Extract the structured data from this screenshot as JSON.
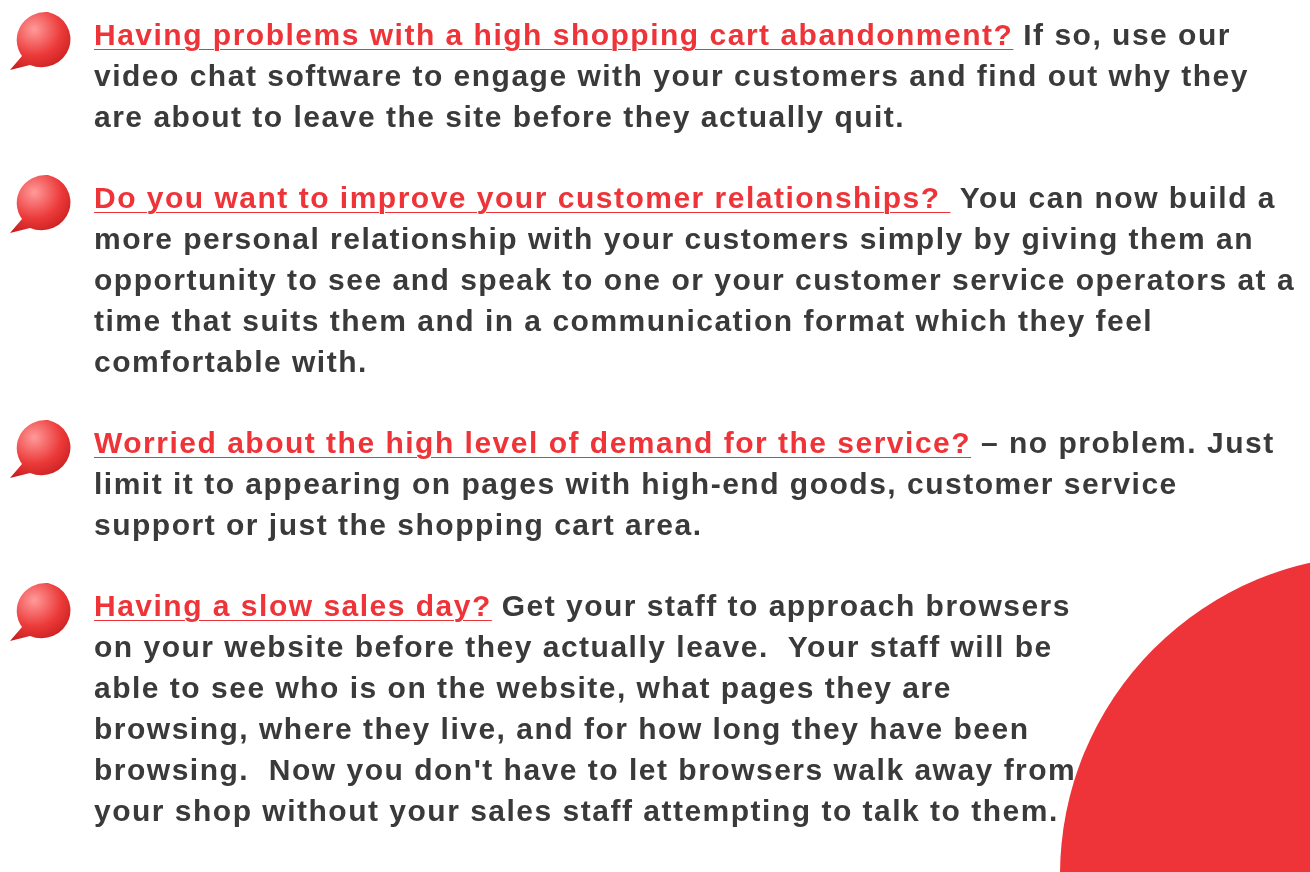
{
  "items": [
    {
      "question": "Having problems with a high shopping cart abandonment?",
      "text": "If so, use our video chat software to engage with your customers and find out why they are about to leave the site before they actually quit."
    },
    {
      "question": "Do you want to improve your customer relationships? ",
      "text": "You can now build a more personal relationship with your customers simply by giving them an opportunity to see and speak to one or your customer service operators at a time that suits them and in a communication format which they feel comfortable with."
    },
    {
      "question": "Worried about the high level of demand for the service?",
      "text": "– no problem. Just limit it to appearing on pages with high-end goods, customer service support or just the shopping cart area."
    },
    {
      "question": "Having a slow sales day?",
      "text": "Get your staff to approach browsers on your website before they actually leave.  Your staff will be able to see who is on the website, what pages they are browsing, where they live, and for how long they have been browsing.  Now you don't have to let browsers walk away from your shop without your sales staff attempting to talk to them."
    }
  ]
}
